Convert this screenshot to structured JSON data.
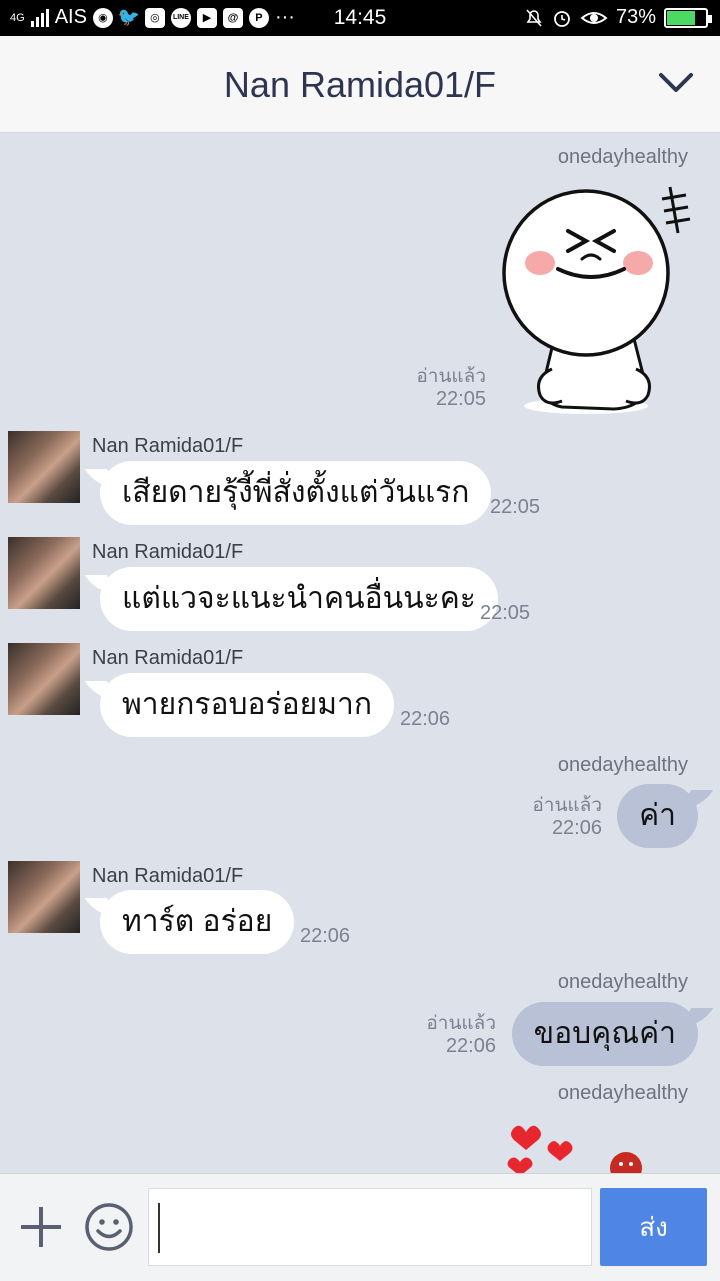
{
  "status_bar": {
    "network": "4G",
    "carrier": "AIS",
    "time": "14:45",
    "battery": "73%",
    "battery_level": 0.73,
    "app_icons": [
      "chrome-icon",
      "twitter-icon",
      "instagram-icon",
      "line-icon",
      "youtube-icon",
      "at-sign-icon",
      "pinterest-icon"
    ],
    "dots": "···"
  },
  "header": {
    "title": "Nan Ramida01/F"
  },
  "messages": [
    {
      "type": "sticker",
      "sender": "onedayhealthy",
      "read": "อ่านแล้ว",
      "time": "22:05"
    },
    {
      "type": "in",
      "sender": "Nan Ramida01/F",
      "text": "เสียดายรุ้งี้พี่สั่งตั้งแต่วันแรก",
      "time": "22:05"
    },
    {
      "type": "in",
      "sender": "Nan Ramida01/F",
      "text": "แต่แวจะแนะนำคนอื่นนะคะ",
      "time": "22:05"
    },
    {
      "type": "in",
      "sender": "Nan Ramida01/F",
      "text": "พายกรอบอร่อยมาก",
      "time": "22:06"
    },
    {
      "type": "out",
      "sender": "onedayhealthy",
      "text": "ค่า",
      "read": "อ่านแล้ว",
      "time": "22:06"
    },
    {
      "type": "in",
      "sender": "Nan Ramida01/F",
      "text": "ทาร์ต อร่อย",
      "time": "22:06"
    },
    {
      "type": "out",
      "sender": "onedayhealthy",
      "text": "ขอบคุณค่า",
      "read": "อ่านแล้ว",
      "time": "22:06"
    },
    {
      "type": "sticker",
      "sender": "onedayhealthy"
    }
  ],
  "input": {
    "send_label": "ส่ง",
    "value": ""
  },
  "colors": {
    "accent": "#4f86e6",
    "bubble_out": "#b8c1d6",
    "background": "#dde2ea"
  }
}
